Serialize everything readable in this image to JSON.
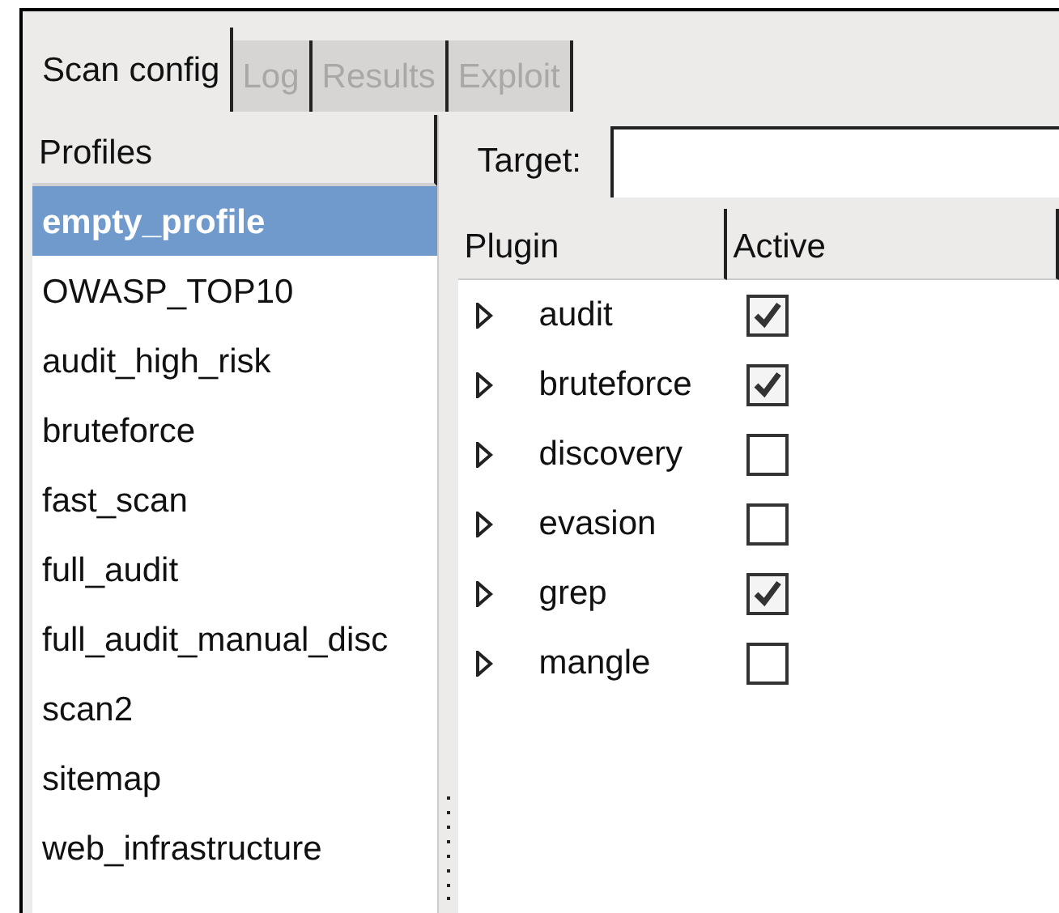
{
  "tabs": [
    {
      "label": "Scan config",
      "selected": true,
      "disabled": false
    },
    {
      "label": "Log",
      "selected": false,
      "disabled": true
    },
    {
      "label": "Results",
      "selected": false,
      "disabled": true
    },
    {
      "label": "Exploit",
      "selected": false,
      "disabled": true
    }
  ],
  "profiles": {
    "header": "Profiles",
    "items": [
      {
        "label": "empty_profile",
        "selected": true
      },
      {
        "label": "OWASP_TOP10",
        "selected": false
      },
      {
        "label": "audit_high_risk",
        "selected": false
      },
      {
        "label": "bruteforce",
        "selected": false
      },
      {
        "label": "fast_scan",
        "selected": false
      },
      {
        "label": "full_audit",
        "selected": false
      },
      {
        "label": "full_audit_manual_disc",
        "selected": false
      },
      {
        "label": "scan2",
        "selected": false
      },
      {
        "label": "sitemap",
        "selected": false
      },
      {
        "label": "web_infrastructure",
        "selected": false
      }
    ]
  },
  "target": {
    "label": "Target:"
  },
  "plugins": {
    "columns": [
      "Plugin",
      "Active"
    ],
    "rows": [
      {
        "name": "audit",
        "expanded": false,
        "active": true
      },
      {
        "name": "bruteforce",
        "expanded": false,
        "active": true
      },
      {
        "name": "discovery",
        "expanded": false,
        "active": false
      },
      {
        "name": "evasion",
        "expanded": false,
        "active": false
      },
      {
        "name": "grep",
        "expanded": false,
        "active": true
      },
      {
        "name": "mangle",
        "expanded": false,
        "active": false
      }
    ]
  }
}
